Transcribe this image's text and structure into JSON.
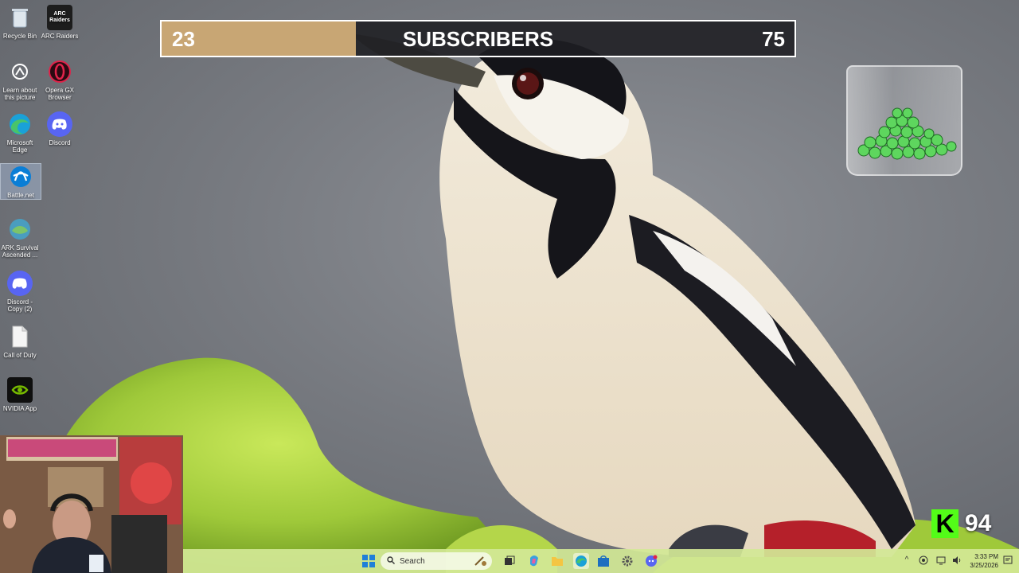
{
  "desktop": {
    "icons": [
      {
        "label": "Recycle Bin",
        "icon": "recycle-bin-icon"
      },
      {
        "label": "ARC Raiders",
        "icon": "arc-raiders-icon"
      },
      {
        "label": "Learn about this picture",
        "icon": "learn-picture-icon"
      },
      {
        "label": "Opera GX Browser",
        "icon": "opera-gx-icon"
      },
      {
        "label": "Microsoft Edge",
        "icon": "edge-icon"
      },
      {
        "label": "Discord",
        "icon": "discord-icon"
      },
      {
        "label": "Battle.net",
        "icon": "battlenet-icon"
      },
      {
        "label": "ARK Survival Ascended ...",
        "icon": "ark-icon"
      },
      {
        "label": "Discord - Copy (2)",
        "icon": "discord-icon"
      },
      {
        "label": "Call of Duty",
        "icon": "file-icon"
      },
      {
        "label": "NVIDIA App",
        "icon": "nvidia-icon"
      }
    ],
    "arc_logo_text": "ARC Raiders"
  },
  "overlay": {
    "subscribers": {
      "current": "23",
      "title": "SUBSCRIBERS",
      "goal": "75",
      "progress": 0.3067
    },
    "kick": {
      "logo": "K",
      "count": "94",
      "color": "#53fc18"
    }
  },
  "taskbar": {
    "search_placeholder": "Search",
    "clock_time": "3:33 PM",
    "clock_date": "3/25/2026",
    "tray_up": "^"
  }
}
